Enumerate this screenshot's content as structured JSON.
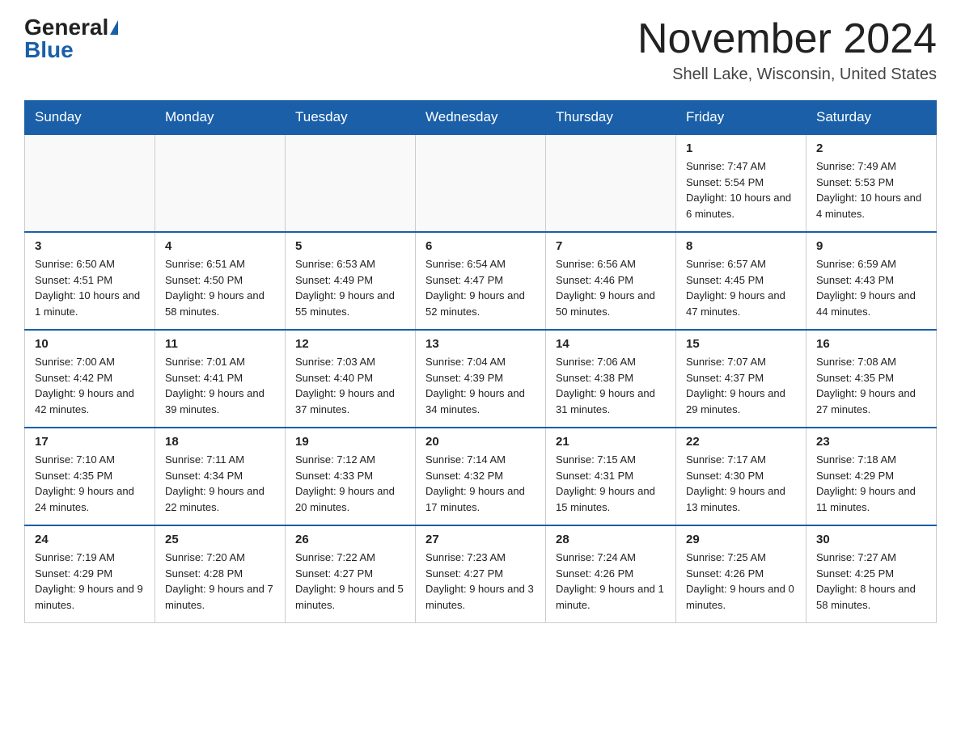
{
  "logo": {
    "general": "General",
    "blue": "Blue"
  },
  "title": "November 2024",
  "location": "Shell Lake, Wisconsin, United States",
  "days_header": [
    "Sunday",
    "Monday",
    "Tuesday",
    "Wednesday",
    "Thursday",
    "Friday",
    "Saturday"
  ],
  "weeks": [
    [
      {
        "day": "",
        "info": ""
      },
      {
        "day": "",
        "info": ""
      },
      {
        "day": "",
        "info": ""
      },
      {
        "day": "",
        "info": ""
      },
      {
        "day": "",
        "info": ""
      },
      {
        "day": "1",
        "info": "Sunrise: 7:47 AM\nSunset: 5:54 PM\nDaylight: 10 hours and 6 minutes."
      },
      {
        "day": "2",
        "info": "Sunrise: 7:49 AM\nSunset: 5:53 PM\nDaylight: 10 hours and 4 minutes."
      }
    ],
    [
      {
        "day": "3",
        "info": "Sunrise: 6:50 AM\nSunset: 4:51 PM\nDaylight: 10 hours and 1 minute."
      },
      {
        "day": "4",
        "info": "Sunrise: 6:51 AM\nSunset: 4:50 PM\nDaylight: 9 hours and 58 minutes."
      },
      {
        "day": "5",
        "info": "Sunrise: 6:53 AM\nSunset: 4:49 PM\nDaylight: 9 hours and 55 minutes."
      },
      {
        "day": "6",
        "info": "Sunrise: 6:54 AM\nSunset: 4:47 PM\nDaylight: 9 hours and 52 minutes."
      },
      {
        "day": "7",
        "info": "Sunrise: 6:56 AM\nSunset: 4:46 PM\nDaylight: 9 hours and 50 minutes."
      },
      {
        "day": "8",
        "info": "Sunrise: 6:57 AM\nSunset: 4:45 PM\nDaylight: 9 hours and 47 minutes."
      },
      {
        "day": "9",
        "info": "Sunrise: 6:59 AM\nSunset: 4:43 PM\nDaylight: 9 hours and 44 minutes."
      }
    ],
    [
      {
        "day": "10",
        "info": "Sunrise: 7:00 AM\nSunset: 4:42 PM\nDaylight: 9 hours and 42 minutes."
      },
      {
        "day": "11",
        "info": "Sunrise: 7:01 AM\nSunset: 4:41 PM\nDaylight: 9 hours and 39 minutes."
      },
      {
        "day": "12",
        "info": "Sunrise: 7:03 AM\nSunset: 4:40 PM\nDaylight: 9 hours and 37 minutes."
      },
      {
        "day": "13",
        "info": "Sunrise: 7:04 AM\nSunset: 4:39 PM\nDaylight: 9 hours and 34 minutes."
      },
      {
        "day": "14",
        "info": "Sunrise: 7:06 AM\nSunset: 4:38 PM\nDaylight: 9 hours and 31 minutes."
      },
      {
        "day": "15",
        "info": "Sunrise: 7:07 AM\nSunset: 4:37 PM\nDaylight: 9 hours and 29 minutes."
      },
      {
        "day": "16",
        "info": "Sunrise: 7:08 AM\nSunset: 4:35 PM\nDaylight: 9 hours and 27 minutes."
      }
    ],
    [
      {
        "day": "17",
        "info": "Sunrise: 7:10 AM\nSunset: 4:35 PM\nDaylight: 9 hours and 24 minutes."
      },
      {
        "day": "18",
        "info": "Sunrise: 7:11 AM\nSunset: 4:34 PM\nDaylight: 9 hours and 22 minutes."
      },
      {
        "day": "19",
        "info": "Sunrise: 7:12 AM\nSunset: 4:33 PM\nDaylight: 9 hours and 20 minutes."
      },
      {
        "day": "20",
        "info": "Sunrise: 7:14 AM\nSunset: 4:32 PM\nDaylight: 9 hours and 17 minutes."
      },
      {
        "day": "21",
        "info": "Sunrise: 7:15 AM\nSunset: 4:31 PM\nDaylight: 9 hours and 15 minutes."
      },
      {
        "day": "22",
        "info": "Sunrise: 7:17 AM\nSunset: 4:30 PM\nDaylight: 9 hours and 13 minutes."
      },
      {
        "day": "23",
        "info": "Sunrise: 7:18 AM\nSunset: 4:29 PM\nDaylight: 9 hours and 11 minutes."
      }
    ],
    [
      {
        "day": "24",
        "info": "Sunrise: 7:19 AM\nSunset: 4:29 PM\nDaylight: 9 hours and 9 minutes."
      },
      {
        "day": "25",
        "info": "Sunrise: 7:20 AM\nSunset: 4:28 PM\nDaylight: 9 hours and 7 minutes."
      },
      {
        "day": "26",
        "info": "Sunrise: 7:22 AM\nSunset: 4:27 PM\nDaylight: 9 hours and 5 minutes."
      },
      {
        "day": "27",
        "info": "Sunrise: 7:23 AM\nSunset: 4:27 PM\nDaylight: 9 hours and 3 minutes."
      },
      {
        "day": "28",
        "info": "Sunrise: 7:24 AM\nSunset: 4:26 PM\nDaylight: 9 hours and 1 minute."
      },
      {
        "day": "29",
        "info": "Sunrise: 7:25 AM\nSunset: 4:26 PM\nDaylight: 9 hours and 0 minutes."
      },
      {
        "day": "30",
        "info": "Sunrise: 7:27 AM\nSunset: 4:25 PM\nDaylight: 8 hours and 58 minutes."
      }
    ]
  ]
}
